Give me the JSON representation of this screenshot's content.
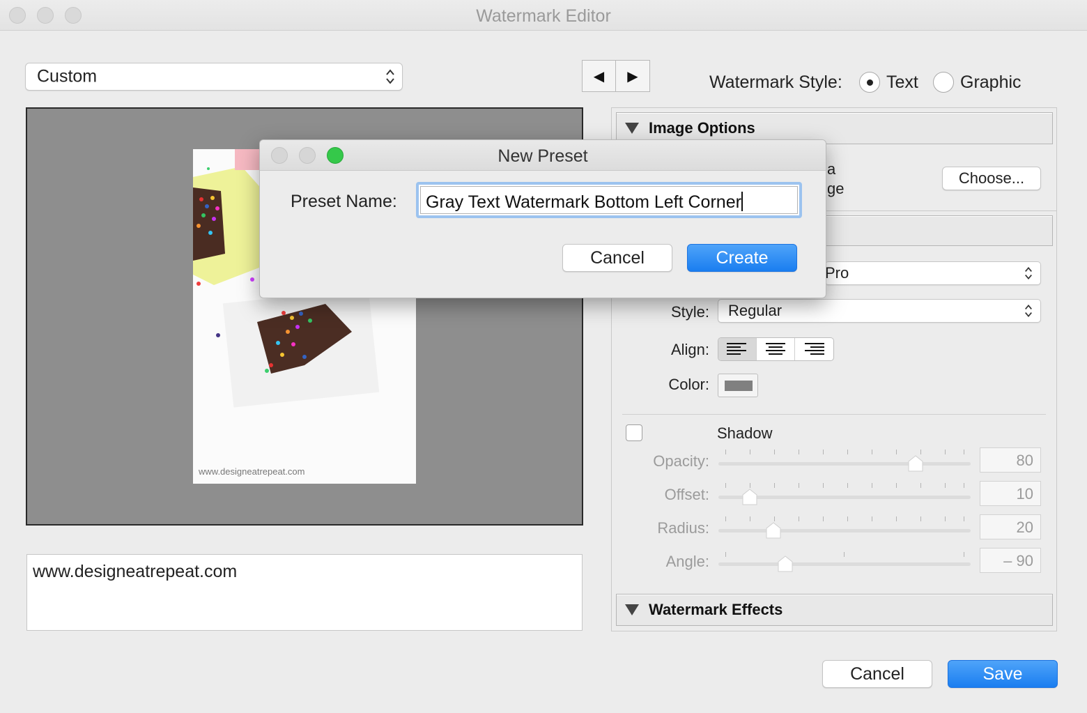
{
  "window": {
    "title": "Watermark Editor"
  },
  "preset_select": {
    "value": "Custom"
  },
  "nav": {
    "prev": "◀",
    "next": "▶"
  },
  "watermark_style": {
    "label": "Watermark Style:",
    "options": [
      "Text",
      "Graphic"
    ],
    "selected": "Text"
  },
  "preview": {
    "photo_watermark": "www.designeatrepeat.com"
  },
  "watermark_text": "www.designeatrepeat.com",
  "image_options": {
    "title": "Image Options",
    "partial_lines": [
      "a",
      "ge"
    ],
    "choose_button": "Choose..."
  },
  "text_options": {
    "font_partial": "Pro",
    "style_label": "Style:",
    "style_value": "Regular",
    "align_label": "Align:",
    "color_label": "Color:",
    "color": "#808080"
  },
  "shadow": {
    "label": "Shadow",
    "checked": false,
    "opacity": {
      "label": "Opacity:",
      "value": "80"
    },
    "offset": {
      "label": "Offset:",
      "value": "10"
    },
    "radius": {
      "label": "Radius:",
      "value": "20"
    },
    "angle": {
      "label": "Angle:",
      "value": "– 90"
    }
  },
  "watermark_effects": {
    "title": "Watermark Effects"
  },
  "footer": {
    "cancel": "Cancel",
    "save": "Save"
  },
  "new_preset_dialog": {
    "title": "New Preset",
    "name_label": "Preset Name:",
    "name_value": "Gray Text Watermark Bottom Left Corner",
    "cancel": "Cancel",
    "create": "Create"
  },
  "colors": {
    "accent": "#1a7ef0",
    "focus_ring": "#9cc3ef",
    "close_green": "#35c84a"
  }
}
